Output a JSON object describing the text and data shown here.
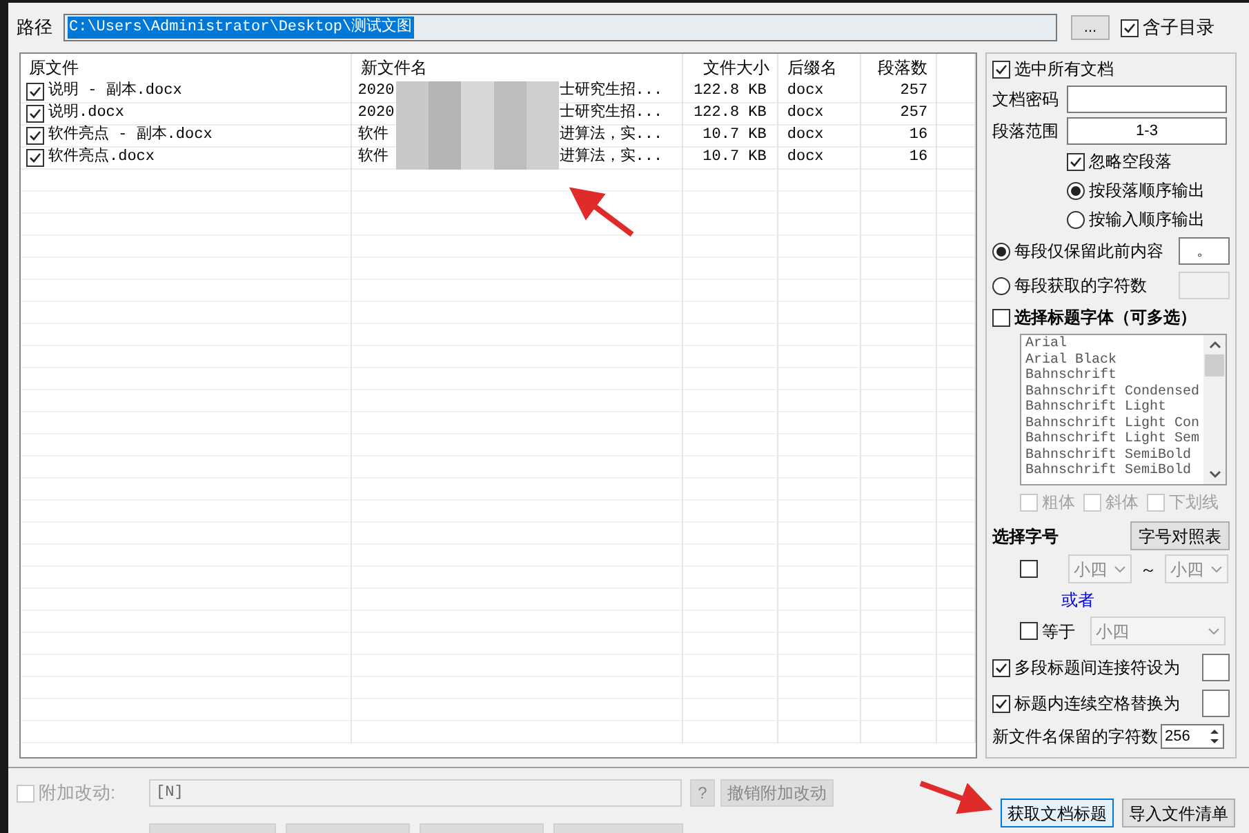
{
  "path": {
    "label": "路径",
    "value": "C:\\Users\\Administrator\\Desktop\\测试文图",
    "browse": "...",
    "include_subdirs": {
      "label": "含子目录",
      "checked": true
    }
  },
  "table": {
    "columns": [
      "原文件",
      "新文件名",
      "文件大小",
      "后缀名",
      "段落数"
    ],
    "rows": [
      {
        "checked": true,
        "original": "说明 - 副本.docx",
        "new_name_start": "2020",
        "new_name_end": "士研究生招...",
        "size": "122.8 KB",
        "ext": "docx",
        "paragraphs": "257"
      },
      {
        "checked": true,
        "original": "说明.docx",
        "new_name_start": "2020",
        "new_name_end": "士研究生招...",
        "size": "122.8 KB",
        "ext": "docx",
        "paragraphs": "257"
      },
      {
        "checked": true,
        "original": "软件亮点 - 副本.docx",
        "new_name_start": "软件",
        "new_name_end": "进算法，实...",
        "size": "10.7 KB",
        "ext": "docx",
        "paragraphs": "16"
      },
      {
        "checked": true,
        "original": "软件亮点.docx",
        "new_name_start": "软件",
        "new_name_end": "进算法，实...",
        "size": "10.7 KB",
        "ext": "docx",
        "paragraphs": "16"
      }
    ]
  },
  "options": {
    "select_all": {
      "label": "选中所有文档",
      "checked": true
    },
    "password": {
      "label": "文档密码"
    },
    "para_range": {
      "label": "段落范围",
      "value": "1-3"
    },
    "ignore_empty": {
      "label": "忽略空段落",
      "checked": true
    },
    "order": [
      {
        "label": "按段落顺序输出",
        "selected": true
      },
      {
        "label": "按输入顺序输出",
        "selected": false
      }
    ],
    "mode": [
      {
        "label": "每段仅保留此前内容",
        "selected": true,
        "value": "。"
      },
      {
        "label": "每段获取的字符数",
        "selected": false
      }
    ],
    "font_select": {
      "label": "选择标题字体（可多选）",
      "checked": false,
      "fonts": [
        "Arial",
        "Arial Black",
        "Bahnschrift",
        "Bahnschrift Condensed",
        "Bahnschrift Light",
        "Bahnschrift Light Con",
        "Bahnschrift Light Sem",
        "Bahnschrift SemiBold",
        "Bahnschrift SemiBold"
      ],
      "styles": [
        {
          "label": "粗体",
          "checked": false,
          "disabled": true
        },
        {
          "label": "斜体",
          "checked": false,
          "disabled": true
        },
        {
          "label": "下划线",
          "checked": false,
          "disabled": true
        }
      ]
    },
    "size": {
      "label": "选择字号",
      "table_button": "字号对照表",
      "range": {
        "checked": false,
        "from": "小四",
        "separator": "～",
        "to": "小四",
        "disabled": true
      },
      "or": "或者",
      "equal": {
        "label": "等于",
        "checked": false,
        "value": "小四",
        "disabled": true
      }
    },
    "connector": {
      "label": "多段标题间连接符设为",
      "checked": true
    },
    "space_replace": {
      "label": "标题内连续空格替换为",
      "checked": true
    },
    "keep_chars": {
      "label": "新文件名保留的字符数",
      "value": "256"
    }
  },
  "append": {
    "label": "附加改动:",
    "checked": false,
    "value": "[N]",
    "help": "?",
    "undo": "撤销附加改动",
    "disabled": true
  },
  "buttons": [
    {
      "label": "获取文档标题",
      "focused": true
    },
    {
      "label": "导入文件清单",
      "focused": false
    }
  ]
}
